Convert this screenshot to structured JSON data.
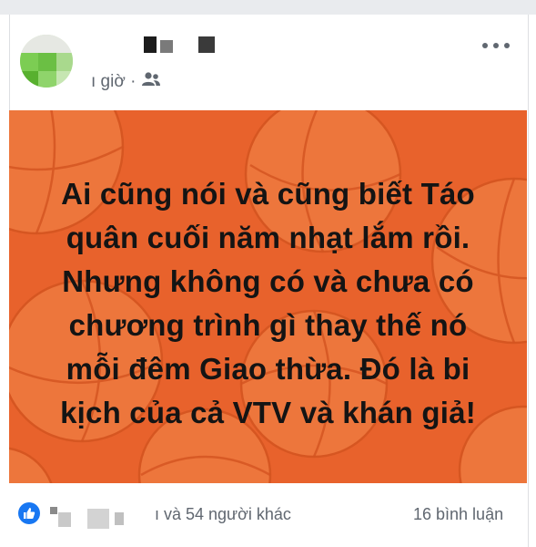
{
  "post": {
    "author_name": "",
    "time_label": "ı giờ ·",
    "audience_icon": "friends-icon",
    "more_icon": "more-options-icon"
  },
  "image": {
    "background_color": "#e8622c",
    "decoration": "basketball-pattern",
    "lines": [
      "Ai cũng nói và cũng biết Táo",
      "quân cuối năm nhạt lắm rồi.",
      "Nhưng không có và chưa có",
      "chương trình gì thay thế nó",
      "mỗi đêm Giao thừa. Đó là bi",
      "kịch của cả VTV và khán giả!"
    ]
  },
  "footer": {
    "reaction_icon": "like-icon",
    "reactors_text": "ı và 54 người khác",
    "comments_text": "16 bình luận"
  },
  "colors": {
    "accent_blue": "#1877f2",
    "meta_gray": "#606770",
    "orange": "#e8622c"
  }
}
